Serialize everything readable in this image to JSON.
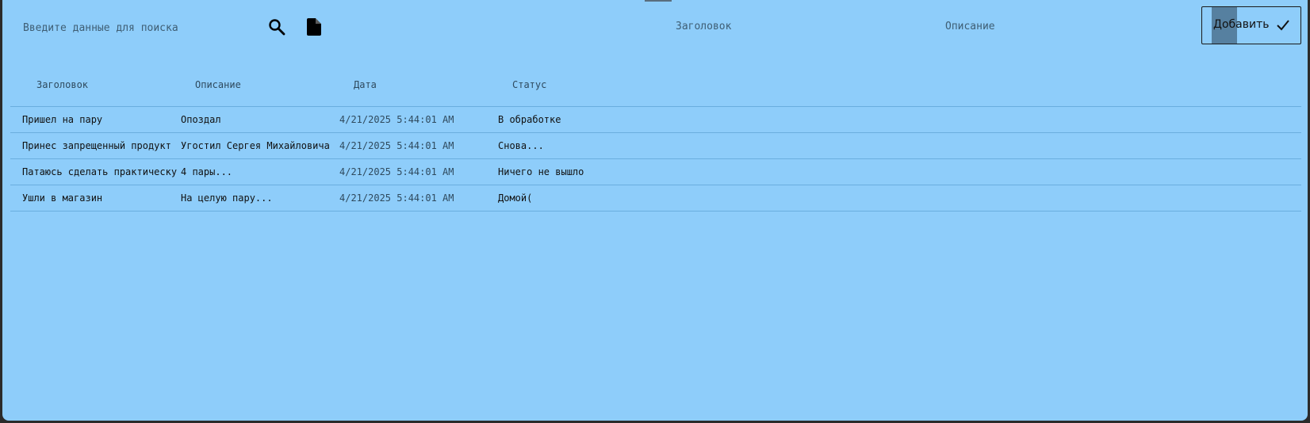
{
  "toolbar": {
    "search_placeholder": "Введите данные для поиска",
    "search_icon": "search-icon",
    "file_icon": "file-icon",
    "title_field_label": "Заголовок",
    "description_field_label": "Описание",
    "add_button_label": "Добавить",
    "add_button_icon": "check-icon"
  },
  "table": {
    "columns": [
      "Заголовок",
      "Описание",
      "Дата",
      "Статус"
    ],
    "rows": [
      [
        "Пришел на пару",
        "Опоздал",
        "4/21/2025 5:44:01 AM",
        "В обработке"
      ],
      [
        "Принес запрещенный продукт",
        "Угостил Сергея Михайловича",
        "4/21/2025 5:44:01 AM",
        "Снова..."
      ],
      [
        "Патаюсь сделать практическую",
        "4 пары...",
        "4/21/2025 5:44:01 AM",
        "Ничего не вышло"
      ],
      [
        "Ушли в магазин",
        "На целую пару...",
        "4/21/2025 5:44:01 AM",
        "Домой("
      ]
    ]
  },
  "colors": {
    "background": "#8ecdfa",
    "frame": "#2b2b2b",
    "divider": "#6aaede",
    "button_press": "#5680a0"
  }
}
